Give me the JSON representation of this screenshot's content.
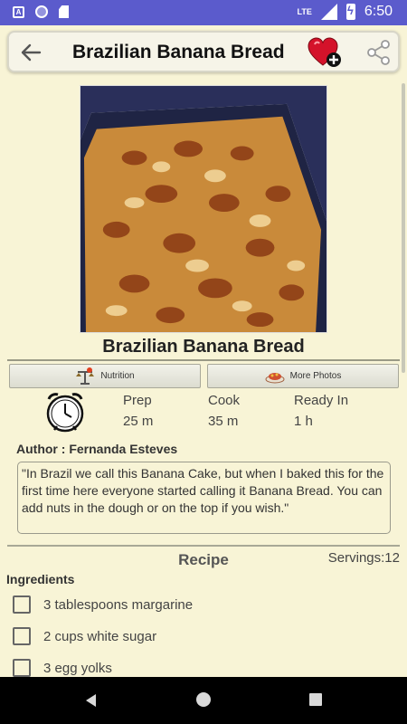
{
  "status_bar": {
    "time": "6:50",
    "network": "LTE"
  },
  "toolbar": {
    "title": "Brazilian Banana Bread"
  },
  "recipe": {
    "title": "Brazilian Banana Bread",
    "tabs": [
      {
        "label": "Nutrition"
      },
      {
        "label": "More Photos"
      }
    ],
    "times": [
      {
        "label": "Prep",
        "value": "25 m"
      },
      {
        "label": "Cook",
        "value": "35 m"
      },
      {
        "label": "Ready In",
        "value": "1 h"
      }
    ],
    "author": "Author : Fernanda Esteves",
    "description": "\"In Brazil we call this Banana Cake, but when I baked this for the first time here everyone started calling it Banana Bread. You can add nuts in the dough or on the top if you wish.\"",
    "section_title": "Recipe",
    "servings": "Servings:12",
    "ingredients_heading": "Ingredients",
    "ingredients": [
      {
        "text": "3 tablespoons margarine",
        "checked": false
      },
      {
        "text": "2 cups white sugar",
        "checked": false
      },
      {
        "text": "3 egg yolks",
        "checked": false
      }
    ]
  },
  "colors": {
    "status_bar": "#5b5bcc",
    "background": "#f8f4d6",
    "heart": "#d4122a"
  }
}
